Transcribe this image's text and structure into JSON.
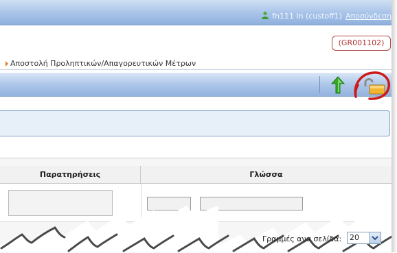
{
  "header": {
    "user_label": "fn111 ln (custoff1)",
    "logout_label": "Αποσύνδεση",
    "code_badge": "(GR001102)"
  },
  "breadcrumb": {
    "current": "Αποστολή Προληπτικών/Απαγορευτικών Μέτρων"
  },
  "toolbar": {
    "icons": [
      "green-up-arrow-icon",
      "unlock-icon"
    ],
    "highlight_color": "#cc1a1a"
  },
  "grid": {
    "columns": [
      "Παρατηρήσεις",
      "Γλώσσα"
    ],
    "row": {
      "remarks_value": "",
      "language_code": "",
      "language_name": ""
    }
  },
  "pagination": {
    "rows_per_page_label": "Γραμμές ανα σελίδα:",
    "rows_per_page_value": "20"
  },
  "colors": {
    "header_blue": "#a7c3e8",
    "badge_red": "#b03030",
    "breadcrumb_arrow": "#e07a2a",
    "panel_bg": "#e7eff8"
  }
}
